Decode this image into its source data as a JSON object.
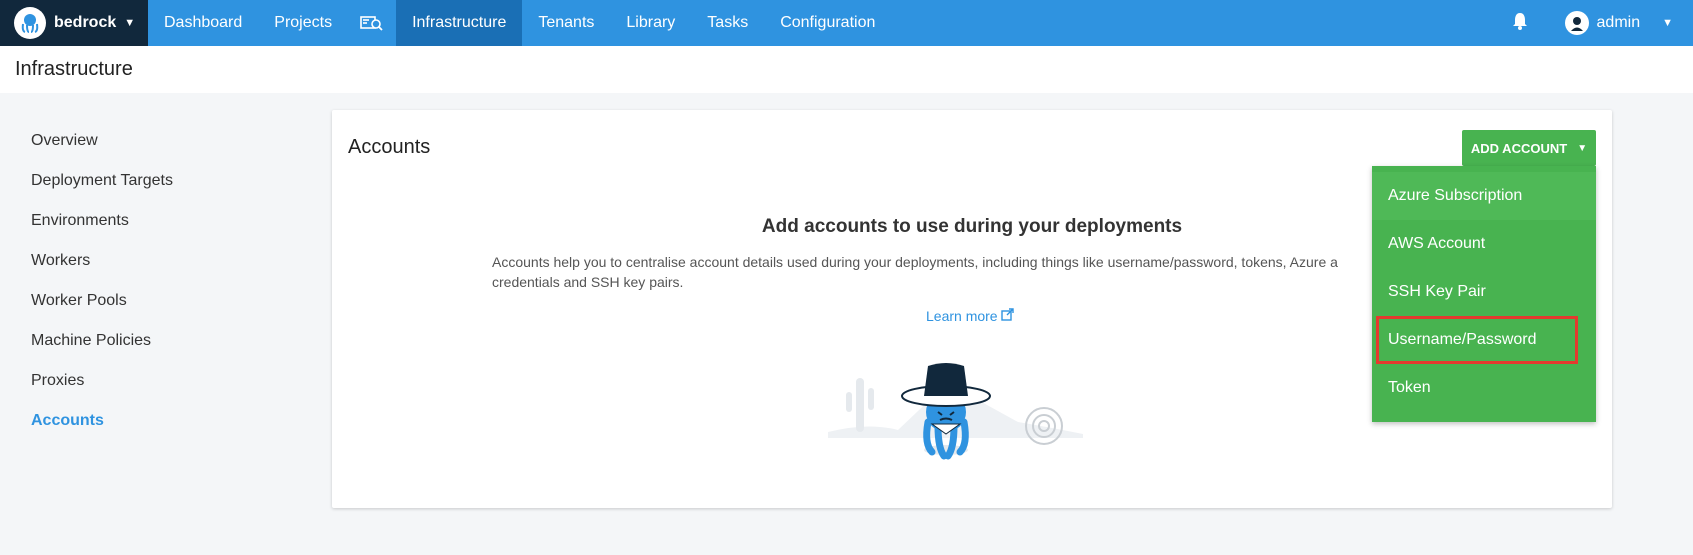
{
  "topnav": {
    "brand": "bedrock",
    "items": [
      {
        "label": "Dashboard"
      },
      {
        "label": "Projects"
      },
      {
        "label": "Infrastructure"
      },
      {
        "label": "Tenants"
      },
      {
        "label": "Library"
      },
      {
        "label": "Tasks"
      },
      {
        "label": "Configuration"
      }
    ],
    "user": "admin"
  },
  "page": {
    "title": "Infrastructure"
  },
  "sidebar": {
    "items": [
      {
        "label": "Overview"
      },
      {
        "label": "Deployment Targets"
      },
      {
        "label": "Environments"
      },
      {
        "label": "Workers"
      },
      {
        "label": "Worker Pools"
      },
      {
        "label": "Machine Policies"
      },
      {
        "label": "Proxies"
      },
      {
        "label": "Accounts"
      }
    ]
  },
  "card": {
    "title": "Accounts",
    "add_button": "ADD ACCOUNT",
    "empty_title": "Add accounts to use during your deployments",
    "empty_desc": "Accounts help you to centralise account details used during your deployments, including things like username/password, tokens, Azure a credentials and SSH key pairs.",
    "learn_more": "Learn more"
  },
  "dropdown": {
    "items": [
      {
        "label": "Azure Subscription"
      },
      {
        "label": "AWS Account"
      },
      {
        "label": "SSH Key Pair"
      },
      {
        "label": "Username/Password"
      },
      {
        "label": "Token"
      }
    ]
  },
  "colors": {
    "nav": "#2f93e0",
    "nav_active": "#1a6fb5",
    "brand_bg": "#11283c",
    "accent_green": "#48b350",
    "highlight_red": "#e53a2e"
  }
}
